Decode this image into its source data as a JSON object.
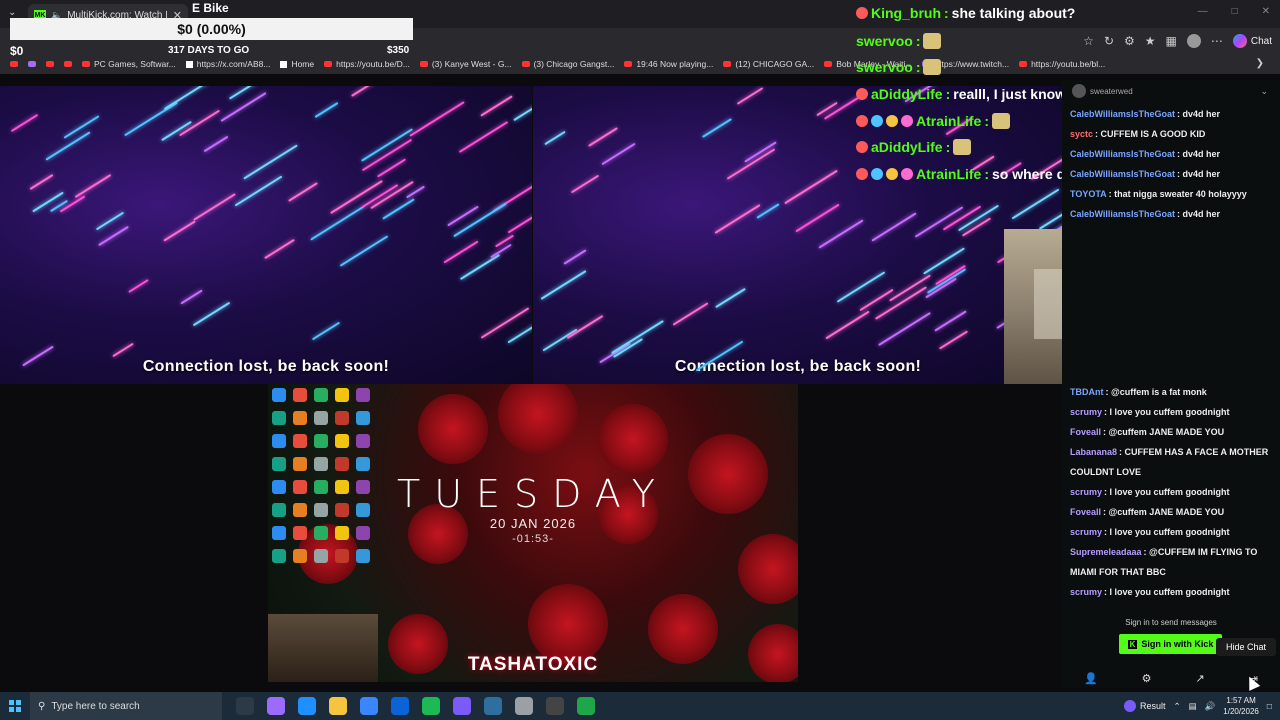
{
  "browser": {
    "tab_title": "MultiKick.com: Watch Multipl",
    "tab_favicon": "MK",
    "bookmarks": [
      {
        "label": "",
        "icon": "youtube"
      },
      {
        "label": "",
        "icon": "twitch"
      },
      {
        "label": "",
        "icon": "youtube"
      },
      {
        "label": "",
        "icon": "youtube"
      },
      {
        "label": "PC Games, Softwar...",
        "icon": "youtube"
      },
      {
        "label": "https://x.com/AB8...",
        "icon": "x"
      },
      {
        "label": "Home",
        "icon": "x"
      },
      {
        "label": "https://youtu.be/D...",
        "icon": "youtube"
      },
      {
        "label": "(3) Kanye West - G...",
        "icon": "youtube"
      },
      {
        "label": "(3) Chicago Gangst...",
        "icon": "youtube"
      },
      {
        "label": "19:46 Now playing...",
        "icon": "youtube"
      },
      {
        "label": "(12) CHICAGO GA...",
        "icon": "youtube"
      },
      {
        "label": "Bob Marley - Waiti...",
        "icon": "youtube"
      },
      {
        "label": "https://www.twitch...",
        "icon": "twitch"
      },
      {
        "label": "https://youtu.be/bl...",
        "icon": "youtube"
      }
    ],
    "chat_button_label": "Chat"
  },
  "overlay": {
    "title": "E Bike",
    "amount": "$0 (0.00%)",
    "left_amount": "$0",
    "days": "317 DAYS TO GO",
    "goal": "$350"
  },
  "overlay_chat": [
    {
      "name": "King_bruh",
      "msg": "she talking about?",
      "color": "#53fc18",
      "emote": false,
      "badges": 1
    },
    {
      "name": "swervoo",
      "msg": "",
      "color": "#53fc18",
      "emote": true,
      "badges": 0
    },
    {
      "name": "swervoo",
      "msg": "",
      "color": "#53fc18",
      "emote": true,
      "badges": 0
    },
    {
      "name": "aDiddyLife",
      "msg": "realll, I just know cinna a creamer",
      "color": "#53fc18",
      "emote": false,
      "badges": 1
    },
    {
      "name": "AtrainLife",
      "msg": "",
      "color": "#53fc18",
      "emote": true,
      "badges": 4
    },
    {
      "name": "aDiddyLife",
      "msg": "",
      "color": "#53fc18",
      "emote": true,
      "badges": 1
    },
    {
      "name": "AtrainLife",
      "msg": "so where does tasha fit in this",
      "color": "#53fc18",
      "emote": false,
      "badges": 4
    }
  ],
  "streams": {
    "pane1_status": "Connection lost, be back soon!",
    "pane2_status": "Connection lost, be back soon!",
    "desktop_day": "TUESDAY",
    "desktop_date": "20 JAN 2026",
    "desktop_time": "-01:53-",
    "desktop_streamer": "TASHATOXIC"
  },
  "chat": {
    "streamer": "sweaterwed",
    "top_messages": [
      {
        "user": "CalebWilliamsIsTheGoat",
        "text": "dv4d her",
        "color": "#7aa6ff"
      },
      {
        "user": "syctc",
        "text": "CUFFEM IS A GOOD KID",
        "color": "#ff6b6b"
      },
      {
        "user": "CalebWilliamsIsTheGoat",
        "text": "dv4d her",
        "color": "#7aa6ff"
      },
      {
        "user": "CalebWilliamsIsTheGoat",
        "text": "dv4d her",
        "color": "#7aa6ff"
      },
      {
        "user": "TOYOTA",
        "text": "that nigga sweater 40 holayyyy",
        "color": "#7aa6ff"
      },
      {
        "user": "CalebWilliamsIsTheGoat",
        "text": "dv4d her",
        "color": "#7aa6ff"
      }
    ],
    "bottom_messages": [
      {
        "user": "TBDAnt",
        "text": "@cuffem is a fat monk",
        "color": "#7aa6ff"
      },
      {
        "user": "scrumy",
        "text": "I love you cuffem goodnight",
        "color": "#b79cff"
      },
      {
        "user": "Foveall",
        "text": "@cuffem JANE MADE YOU",
        "color": "#b79cff"
      },
      {
        "user": "Labanana8",
        "text": "CUFFEM HAS A FACE A MOTHER",
        "color": "#b79cff"
      },
      {
        "user": "",
        "text": "COULDNT LOVE",
        "color": "#b79cff"
      },
      {
        "user": "scrumy",
        "text": "I love you cuffem goodnight",
        "color": "#b79cff"
      },
      {
        "user": "Foveall",
        "text": "@cuffem JANE MADE YOU",
        "color": "#b79cff"
      },
      {
        "user": "scrumy",
        "text": "I love you cuffem goodnight",
        "color": "#b79cff"
      },
      {
        "user": "Supremeleadaaa",
        "text": "@CUFFEM IM FLYING TO",
        "color": "#b79cff"
      },
      {
        "user": "",
        "text": "MIAMI FOR THAT BBC",
        "color": "#b79cff"
      },
      {
        "user": "scrumy",
        "text": "I love you cuffem goodnight",
        "color": "#b79cff"
      }
    ],
    "signin_prompt": "Sign in to send messages",
    "signin_button": "Sign in with Kick",
    "hide_chat_tooltip": "Hide Chat"
  },
  "taskbar": {
    "search_placeholder": "Type here to search",
    "weather_label": "Result",
    "time": "1:57 AM",
    "date": "1/20/2026"
  },
  "colors": {
    "kick_green": "#53fc18",
    "chat_bg": "#0b0e0f",
    "taskbar_bg": "#1c2b3a"
  }
}
